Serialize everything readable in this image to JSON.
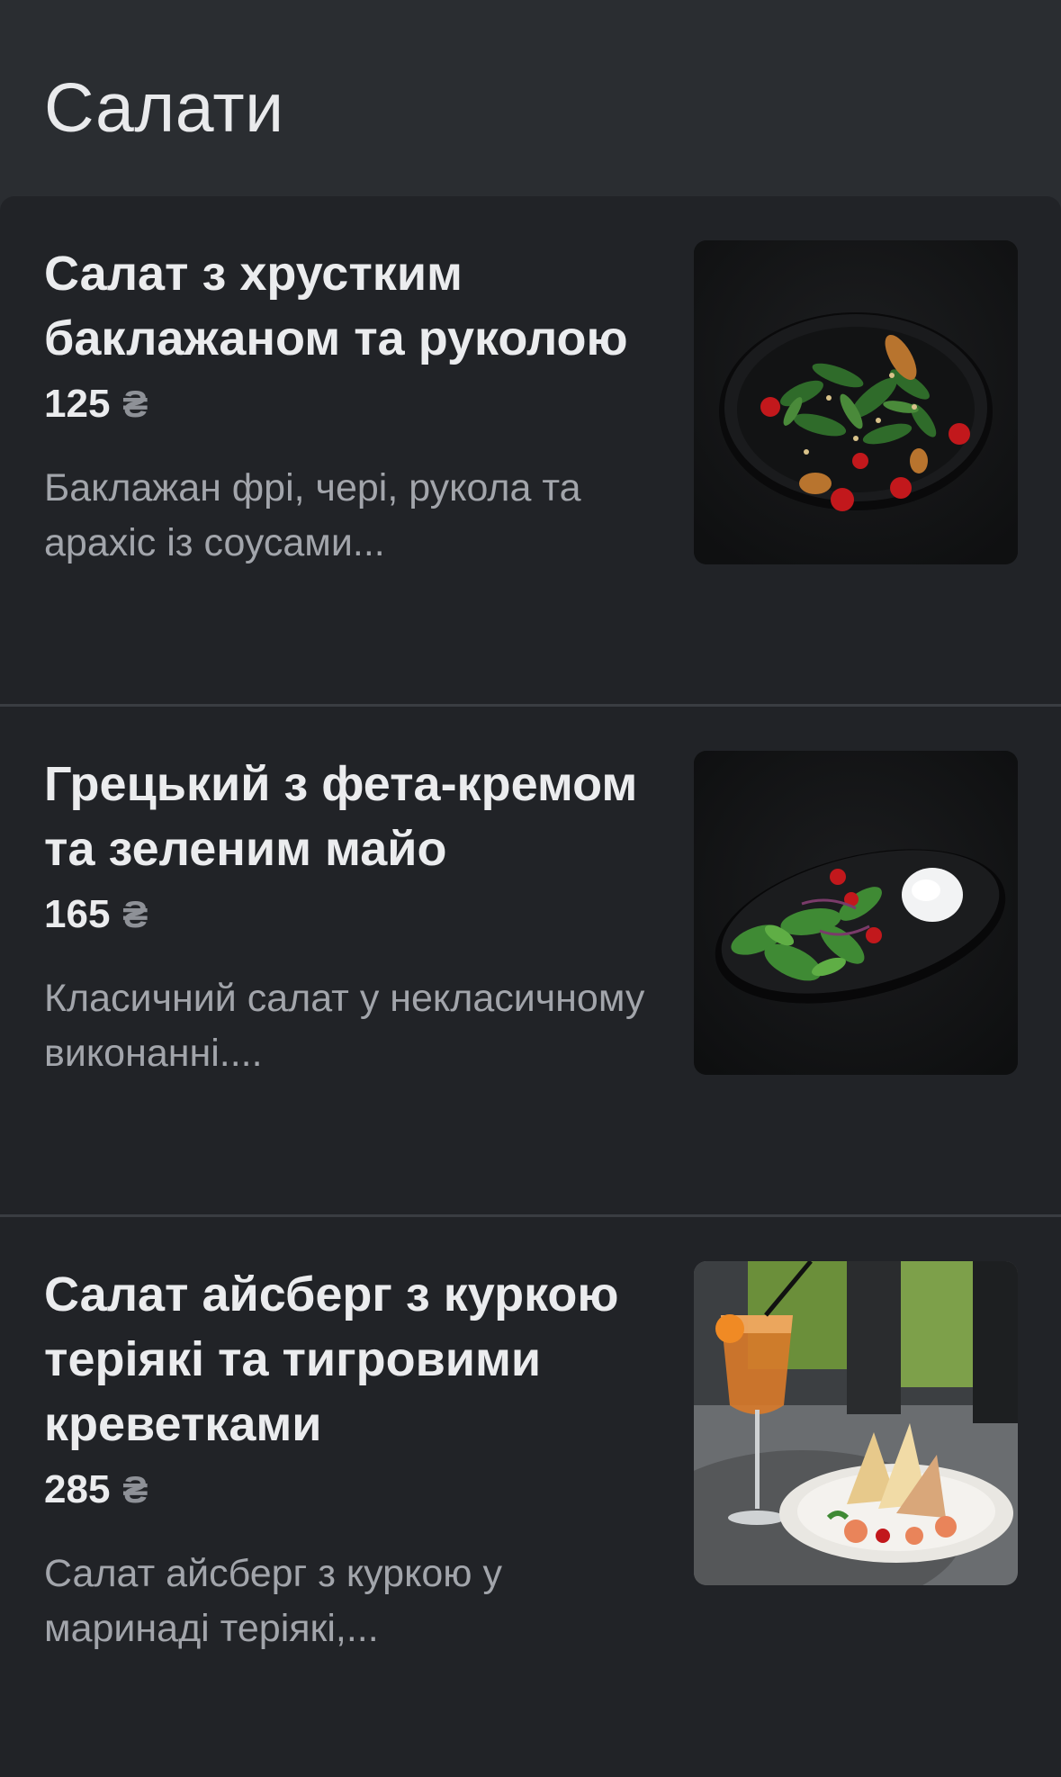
{
  "page": {
    "title": "Салати"
  },
  "items": [
    {
      "name": "Салат з хрустким баклажаном та руколою",
      "price": "125",
      "currency": "₴",
      "description": "Баклажан фрі, чері, рукола та арахіс із соусами..."
    },
    {
      "name": "Грецький з фета-кремом та зеленим майо",
      "price": "165",
      "currency": "₴",
      "description": "Класичний салат у некласичному виконанні...."
    },
    {
      "name": "Салат айсберг з куркою теріякі та тигровими креветками",
      "price": "285",
      "currency": "₴",
      "description": "Салат айсберг з куркою у маринаді теріякі,..."
    }
  ],
  "colors": {
    "background": "#2a2d31",
    "card": "#212327",
    "divider": "#3a3d42",
    "title_text": "#ebecee",
    "description_text": "#a2a5ab",
    "currency_text": "#8e9197"
  }
}
